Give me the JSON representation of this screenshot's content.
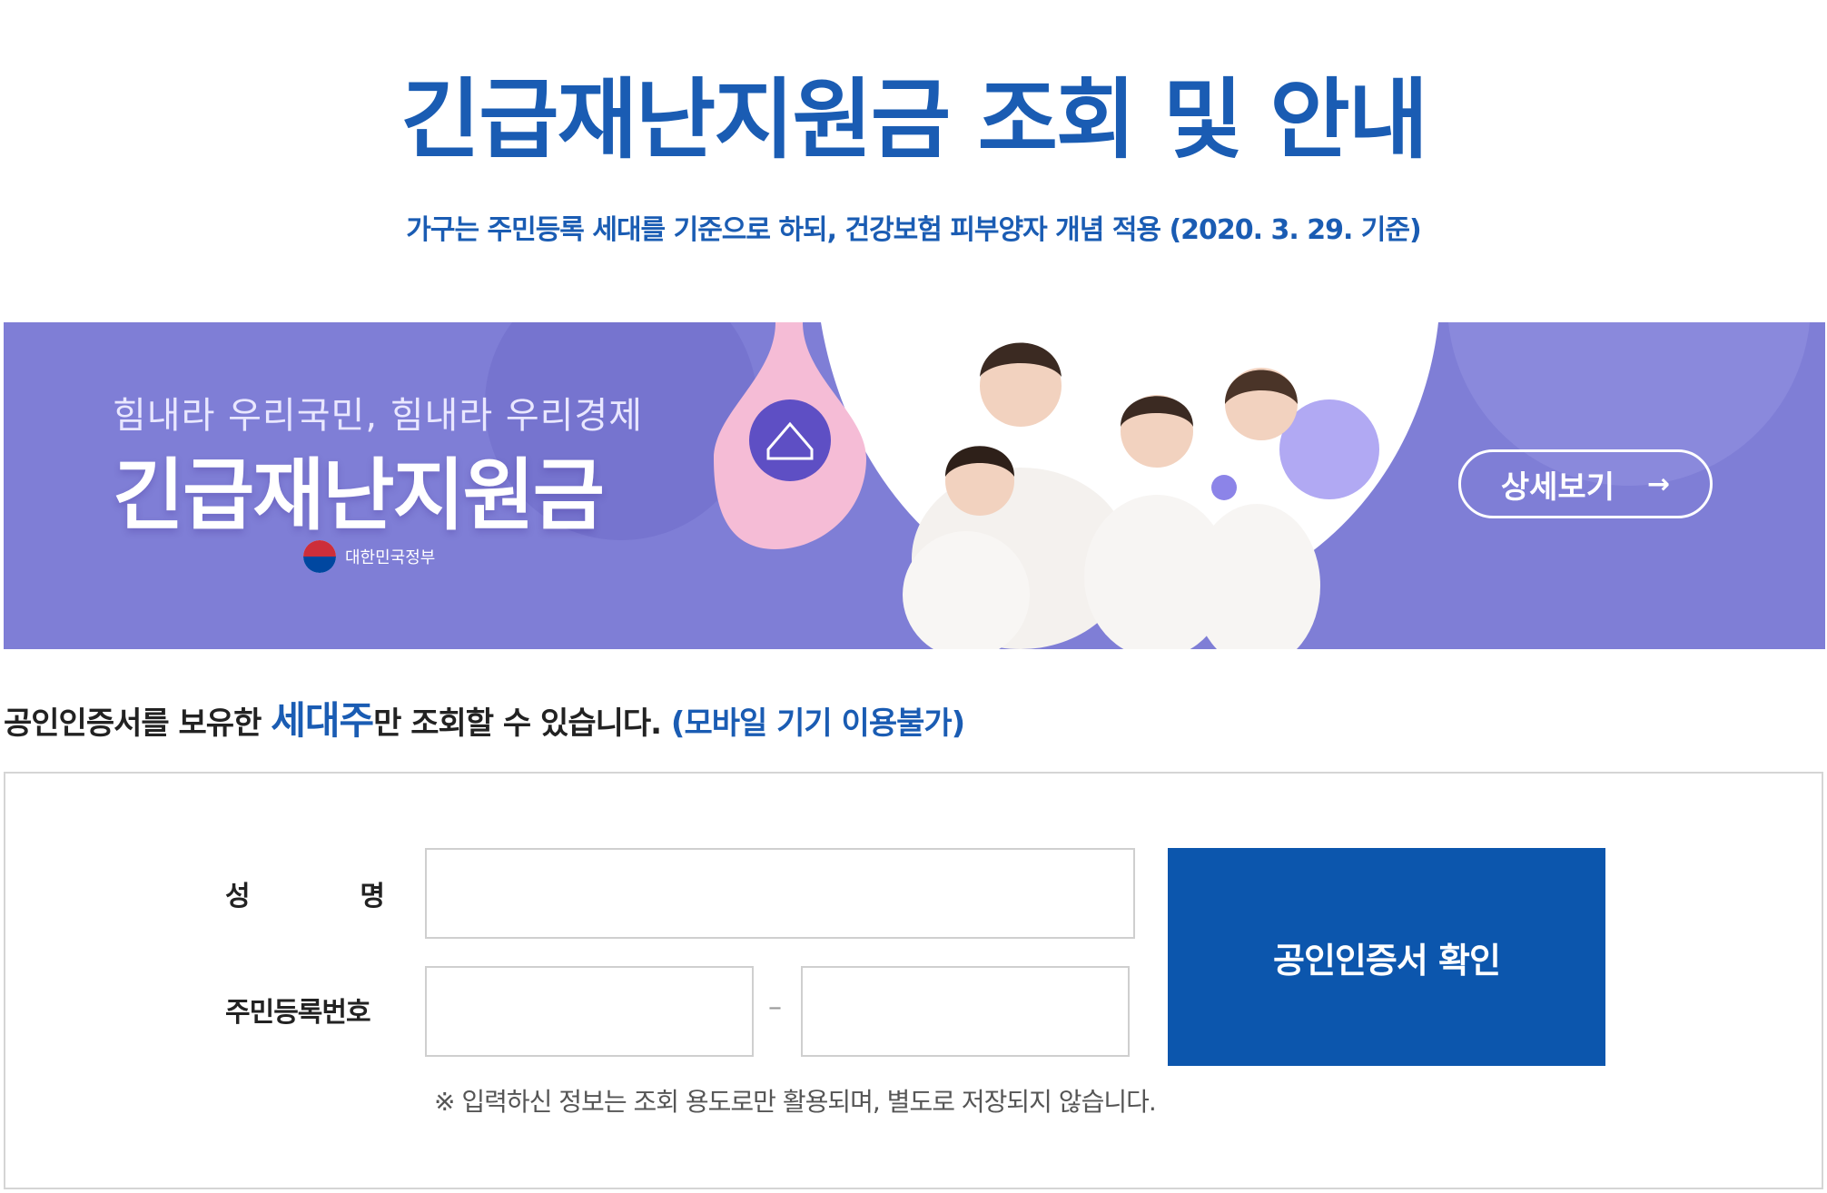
{
  "header": {
    "title": "긴급재난지원금 조회 및 안내",
    "subtitle": "가구는 주민등록 세대를 기준으로 하되, 건강보험 피부양자 개념 적용 (2020. 3. 29. 기준)"
  },
  "banner": {
    "slogan": "힘내라 우리국민, 힘내라 우리경제",
    "title": "긴급재난지원금",
    "gov_label": "대한민국정부",
    "detail_button": "상세보기",
    "detail_arrow": "→",
    "bg_color": "#7f7ed6",
    "accent_pink": "#f5bcd6",
    "accent_purple": "#5e4fc4"
  },
  "notice": {
    "prefix": "공인인증서를 보유한 ",
    "highlight": "세대주",
    "middle": "만 조회할 수 있습니다. ",
    "mobile": "(모바일 기기 이용불가)"
  },
  "form": {
    "name_label_first": "성",
    "name_label_second": "명",
    "name_value": "",
    "rrn_label": "주민등록번호",
    "rrn_front_value": "",
    "rrn_back_value": "",
    "rrn_separator": "–",
    "submit_label": "공인인증서 확인",
    "privacy_note": "※ 입력하신 정보는 조회 용도로만 활용되며, 별도로 저장되지 않습니다.",
    "button_color": "#0c56ad"
  }
}
